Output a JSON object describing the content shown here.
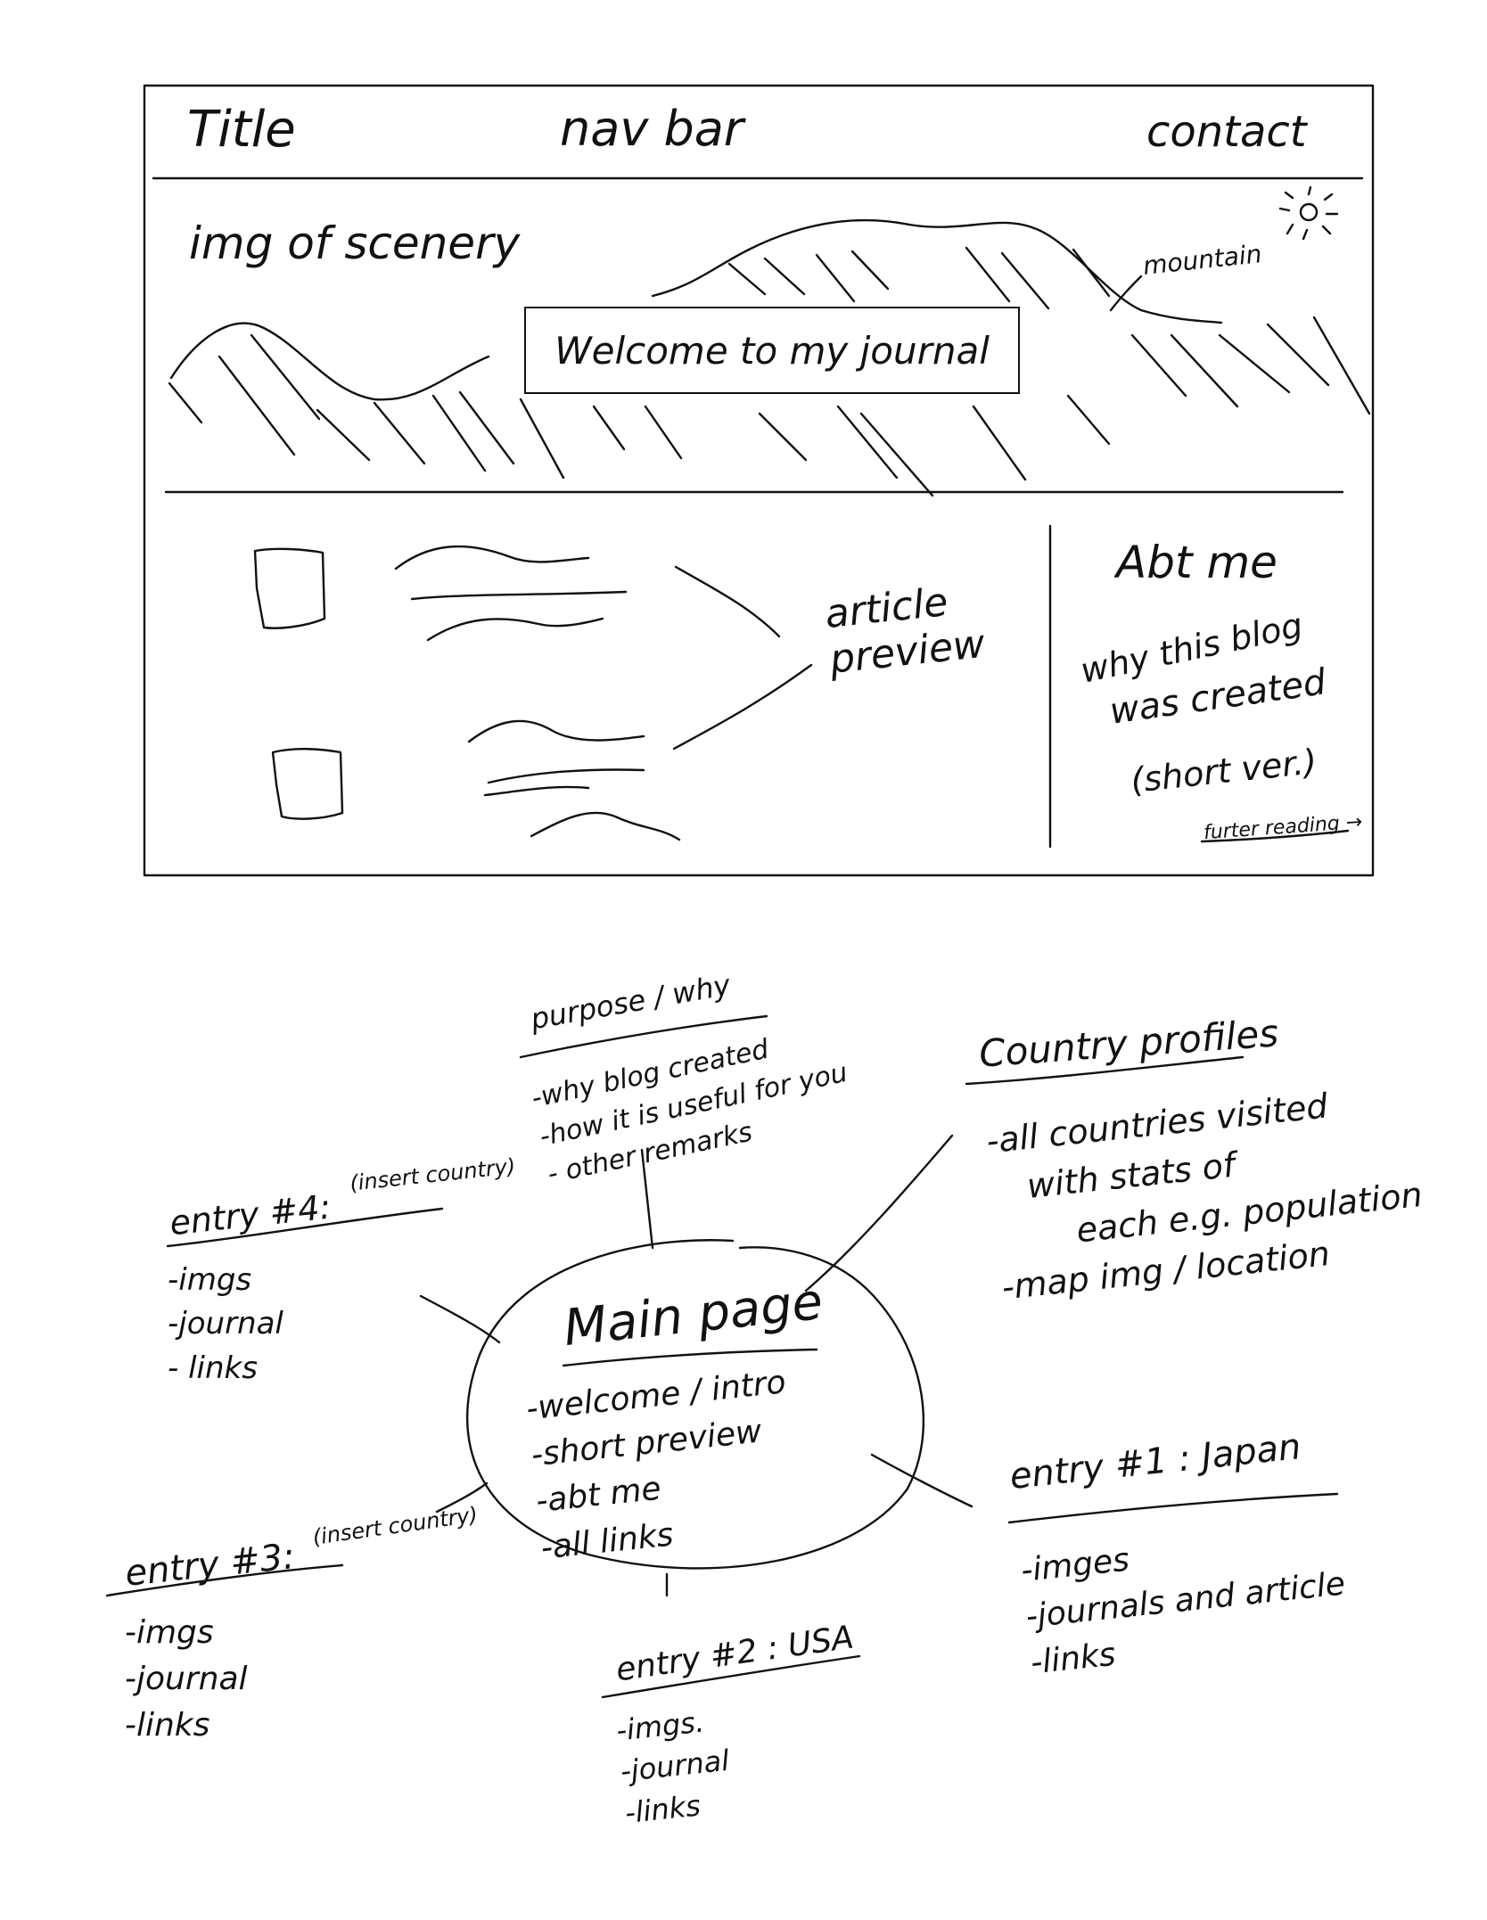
{
  "wireframe": {
    "header": {
      "title": "Title",
      "nav": "nav bar",
      "contact": "contact"
    },
    "hero": {
      "image_label": "img of scenery",
      "mountain_label": "mountain",
      "welcome_text": "Welcome to my journal"
    },
    "content": {
      "preview_label": "article\npreview"
    },
    "about": {
      "heading": "Abt me",
      "line1": "why this blog",
      "line2": "was created",
      "line3": "(short ver.)",
      "link": "furter reading →"
    }
  },
  "mindmap": {
    "center": {
      "title": "Main page",
      "items": [
        "-welcome / intro",
        "-short preview",
        "-abt me",
        "-all links"
      ]
    },
    "purpose": {
      "title": "purpose / why",
      "items": [
        "-why blog created",
        "-how it is useful for you",
        "- other remarks"
      ]
    },
    "profiles": {
      "title": "Country profiles",
      "items": [
        "-all countries visited",
        "with stats of",
        "each e.g. population",
        "-map img / location"
      ]
    },
    "entry4": {
      "title": "entry #4:",
      "note": "(insert country)",
      "items": [
        "-imgs",
        "-journal",
        "- links"
      ]
    },
    "entry3": {
      "title": "entry #3:",
      "note": "(insert country)",
      "items": [
        "-imgs",
        "-journal",
        "-links"
      ]
    },
    "entry2": {
      "title": "entry #2 : USA",
      "items": [
        "-imgs.",
        "-journal",
        "-links"
      ]
    },
    "entry1": {
      "title": "entry #1 : Japan",
      "items": [
        "-imges",
        "-journals and article",
        "-links"
      ]
    }
  }
}
